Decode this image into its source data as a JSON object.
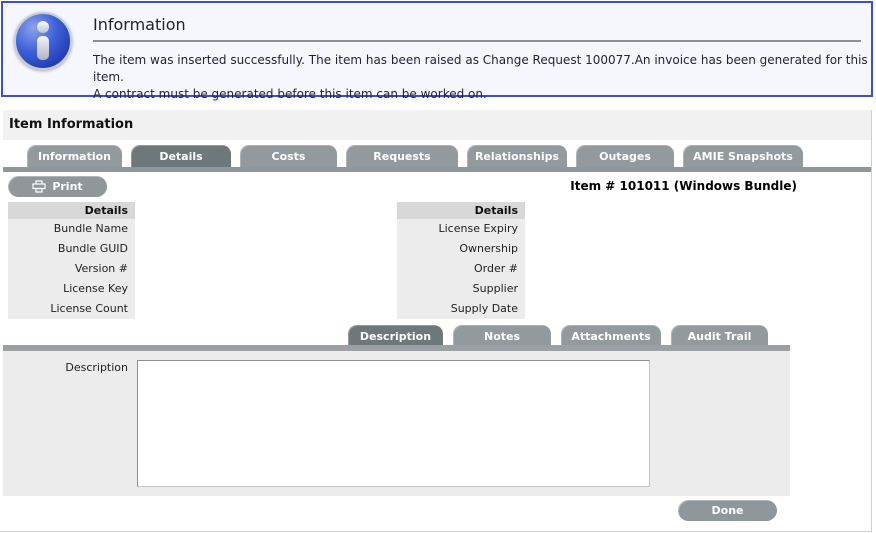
{
  "info_panel": {
    "title": "Information",
    "icon": "info-icon",
    "border_color": "#3b50c9",
    "message_lines": [
      "The item was inserted successfully. The item has been raised as Change Request 100077.An invoice has been generated for this item.",
      "A contract must be generated before this item can be worked on."
    ]
  },
  "section": {
    "heading": "Item Information",
    "main_tabs": [
      {
        "label": "Information",
        "active": false
      },
      {
        "label": "Details",
        "active": true
      },
      {
        "label": "Costs",
        "active": false
      },
      {
        "label": "Requests",
        "active": false
      },
      {
        "label": "Relationships",
        "active": false
      },
      {
        "label": "Outages",
        "active": false
      },
      {
        "label": "AMIE Snapshots",
        "active": false
      }
    ],
    "toolbar": {
      "print_label": "Print",
      "print_icon": "printer-icon",
      "item_title": "Item # 101011 (Windows Bundle)"
    },
    "left_details": {
      "header": "Details",
      "rows": [
        "Bundle Name",
        "Bundle GUID",
        "Version #",
        "License Key",
        "License Count"
      ]
    },
    "right_details": {
      "header": "Details",
      "rows": [
        "License Expiry",
        "Ownership",
        "Order #",
        "Supplier",
        "Supply Date"
      ]
    },
    "sub_tabs": [
      {
        "label": "Description",
        "active": true
      },
      {
        "label": "Notes",
        "active": false
      },
      {
        "label": "Attachments",
        "active": false
      },
      {
        "label": "Audit Trail",
        "active": false
      }
    ],
    "description": {
      "label": "Description",
      "value": ""
    },
    "done_label": "Done"
  },
  "colors": {
    "accent_blue": "#3b50c9",
    "tab_inactive": "#929a9d",
    "tab_active": "#6e777a",
    "tab_bar": "#8f979b",
    "panel_gray": "#ececec",
    "header_gray": "#d8d8d8"
  }
}
